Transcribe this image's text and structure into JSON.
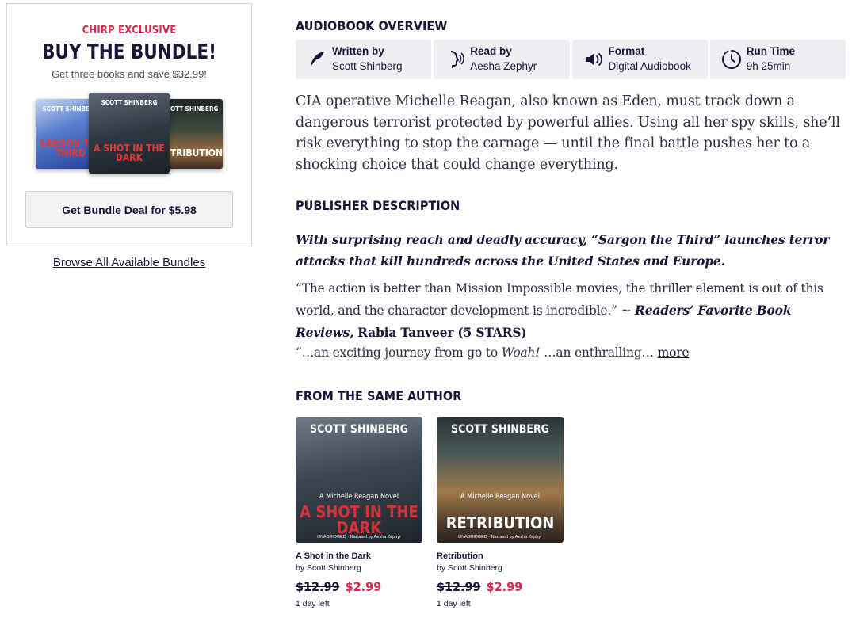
{
  "bundle": {
    "eyebrow": "CHIRP EXCLUSIVE",
    "title": "BUY THE BUNDLE!",
    "subtitle": "Get three books and save $32.99!",
    "covers": [
      {
        "author": "SCOTT SHINBERG",
        "title": "SARGON THE THIRD"
      },
      {
        "author": "SCOTT SHINBERG",
        "title": "A SHOT IN THE DARK"
      },
      {
        "author": "SCOTT SHINBERG",
        "title": "RETRIBUTION"
      }
    ],
    "button_label": "Get Bundle Deal for $5.98",
    "browse_link": "Browse All Available Bundles"
  },
  "overview": {
    "heading": "AUDIOBOOK OVERVIEW",
    "tiles": [
      {
        "icon": "quill-icon",
        "label": "Written by",
        "value": "Scott Shinberg"
      },
      {
        "icon": "narrator-icon",
        "label": "Read by",
        "value": "Aesha Zephyr"
      },
      {
        "icon": "speaker-icon",
        "label": "Format",
        "value": "Digital Audiobook"
      },
      {
        "icon": "clock-icon",
        "label": "Run Time",
        "value": "9h 25min"
      }
    ],
    "summary": "CIA operative Michelle Reagan, also known as Eden, must track down a dangerous terrorist protected by powerful allies. Using all her spy skills, she’ll risk everything to stop the carnage — until the final battle pushes her to a shocking choice that could change everything."
  },
  "publisher": {
    "heading": "PUBLISHER DESCRIPTION",
    "lead": "With surprising reach and deadly accuracy, “Sargon the Third” launches terror attacks that kill hundreds across the United States and Europe.",
    "quote": "“The action is better than Mission Impossible movies, the thriller element is out of this world, and the character development is incredible.” ~",
    "quote_source": "Readers’ Favorite Book Reviews,",
    "quote_rater": "Rabia Tanveer (5 STARS)",
    "tail_prefix": "“…an exciting journey from go to",
    "tail_italic": "Woah!",
    "tail_suffix": "…an enthralling…",
    "more_label": "more"
  },
  "same_author": {
    "heading": "FROM THE SAME AUTHOR",
    "books": [
      {
        "cover_author": "SCOTT SHINBERG",
        "cover_series": "A Michelle Reagan Novel",
        "cover_title": "A SHOT IN THE DARK",
        "cover_credit": "UNABRIDGED · Narrated by Aesha Zephyr",
        "title": "A Shot in the Dark",
        "author": "by Scott Shinberg",
        "old_price": "$12.99",
        "new_price": "$2.99",
        "time_left": "1 day left"
      },
      {
        "cover_author": "SCOTT SHINBERG",
        "cover_series": "A Michelle Reagan Novel",
        "cover_title": "RETRIBUTION",
        "cover_credit": "UNABRIDGED · Narrated by Aesha Zephyr",
        "title": "Retribution",
        "author": "by Scott Shinberg",
        "old_price": "$12.99",
        "new_price": "$2.99",
        "time_left": "1 day left"
      }
    ]
  },
  "colors": {
    "accent": "#e0244c",
    "navy": "#15163a",
    "tile_bg": "#efeff3"
  }
}
